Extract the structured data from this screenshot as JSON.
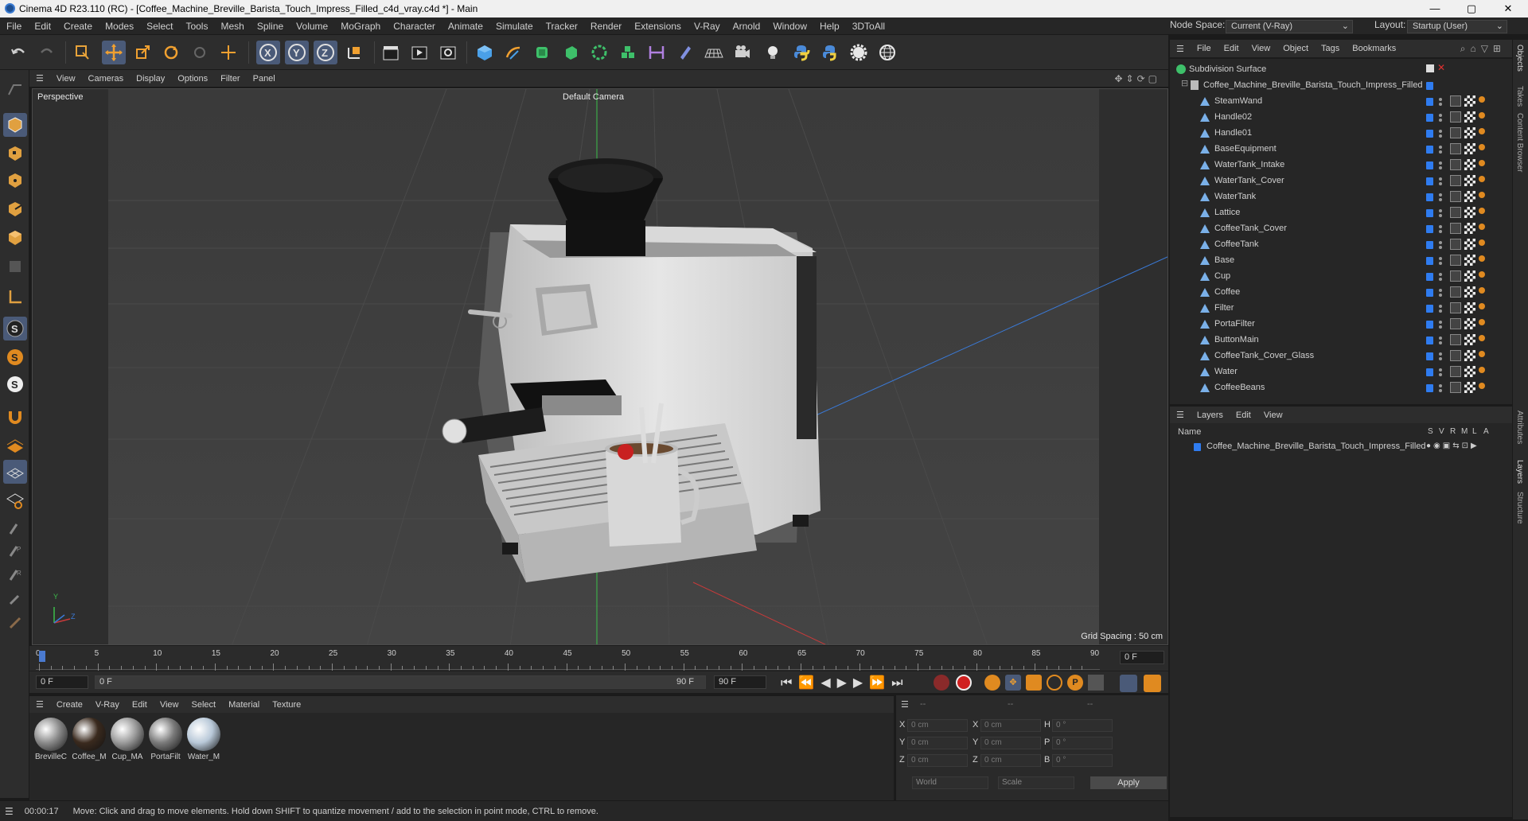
{
  "window": {
    "title": "Cinema 4D R23.110 (RC) - [Coffee_Machine_Breville_Barista_Touch_Impress_Filled_c4d_vray.c4d *] - Main",
    "controls": {
      "minimize": "—",
      "maximize": "▢",
      "close": "✕"
    }
  },
  "menubar": {
    "items": [
      "File",
      "Edit",
      "Create",
      "Modes",
      "Select",
      "Tools",
      "Mesh",
      "Spline",
      "Volume",
      "MoGraph",
      "Character",
      "Animate",
      "Simulate",
      "Tracker",
      "Render",
      "Extensions",
      "V-Ray",
      "Arnold",
      "Window",
      "Help",
      "3DToAll"
    ],
    "node_space_label": "Node Space:",
    "node_space_value": "Current (V-Ray)",
    "layout_label": "Layout:",
    "layout_value": "Startup (User)"
  },
  "viewport": {
    "menu": [
      "View",
      "Cameras",
      "Display",
      "Options",
      "Filter",
      "Panel"
    ],
    "label": "Perspective",
    "camera": "Default Camera",
    "grid_spacing": "Grid Spacing : 50 cm",
    "axis_y": "Y",
    "axis_z": "Z"
  },
  "timeline": {
    "ticks": [
      "0",
      "5",
      "10",
      "15",
      "20",
      "25",
      "30",
      "35",
      "40",
      "45",
      "50",
      "55",
      "60",
      "65",
      "70",
      "75",
      "80",
      "85",
      "90"
    ],
    "current_frame_right": "0 F",
    "start_field": "0 F",
    "range_start": "0 F",
    "range_end": "90 F",
    "end_field": "90 F"
  },
  "materials": {
    "menu": [
      "Create",
      "V-Ray",
      "Edit",
      "View",
      "Select",
      "Material",
      "Texture"
    ],
    "items": [
      {
        "label": "BrevilleC",
        "color": "#8a8a8a"
      },
      {
        "label": "Coffee_M",
        "color": "#3a2a1e"
      },
      {
        "label": "Cup_MA",
        "color": "#9a9a9a"
      },
      {
        "label": "PortaFilt",
        "color": "#7a7a7a"
      },
      {
        "label": "Water_M",
        "color": "#b8c8d8"
      }
    ]
  },
  "coordinates": {
    "headers": [
      "--",
      "--",
      "--"
    ],
    "rows": [
      {
        "a": "X",
        "av": "0 cm",
        "b": "X",
        "bv": "0 cm",
        "c": "H",
        "cv": "0 °"
      },
      {
        "a": "Y",
        "av": "0 cm",
        "b": "Y",
        "bv": "0 cm",
        "c": "P",
        "cv": "0 °"
      },
      {
        "a": "Z",
        "av": "0 cm",
        "b": "Z",
        "bv": "0 cm",
        "c": "B",
        "cv": "0 °"
      }
    ],
    "space": "World",
    "mode": "Scale",
    "apply": "Apply"
  },
  "status": {
    "time": "00:00:17",
    "message": "Move: Click and drag to move elements. Hold down SHIFT to quantize movement / add to the selection in point mode, CTRL to remove."
  },
  "objects": {
    "menu": [
      "File",
      "Edit",
      "View",
      "Object",
      "Tags",
      "Bookmarks"
    ],
    "root": "Subdivision Surface",
    "group": "Coffee_Machine_Breville_Barista_Touch_Impress_Filled",
    "children": [
      "SteamWand",
      "Handle02",
      "Handle01",
      "BaseEquipment",
      "WaterTank_Intake",
      "WaterTank_Cover",
      "WaterTank",
      "Lattice",
      "CoffeeTank_Cover",
      "CoffeeTank",
      "Base",
      "Cup",
      "Coffee",
      "Filter",
      "PortaFilter",
      "ButtonMain",
      "CoffeeTank_Cover_Glass",
      "Water",
      "CoffeeBeans"
    ]
  },
  "layers": {
    "menu": [
      "Layers",
      "Edit",
      "View"
    ],
    "name_header": "Name",
    "col_headers": [
      "S",
      "V",
      "R",
      "M",
      "L",
      "A"
    ],
    "items": [
      "Coffee_Machine_Breville_Barista_Touch_Impress_Filled"
    ]
  },
  "side_tabs": [
    "Objects",
    "Takes",
    "Content Browser",
    "Attributes",
    "Layers",
    "Structure"
  ]
}
